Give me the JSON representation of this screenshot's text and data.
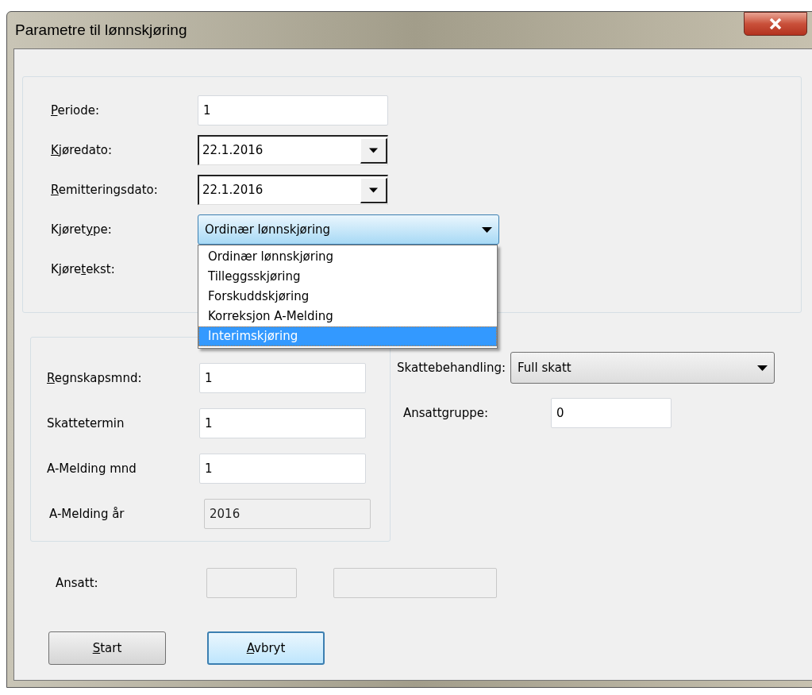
{
  "window": {
    "title": "Parametre til lønnskjøring"
  },
  "run_fields": [
    {
      "kind": "text",
      "label": {
        "key": "P",
        "after": "eriode:"
      },
      "value": "1"
    },
    {
      "kind": "date",
      "label": {
        "key": "K",
        "after": "jøredato:"
      },
      "value": "22.1.2016"
    },
    {
      "kind": "date",
      "label": {
        "key": "R",
        "after": "emitteringsdato:"
      },
      "value": "22.1.2016"
    },
    {
      "kind": "combo",
      "label": {
        "before": "Kjøret",
        "key": "y",
        "after": "pe:"
      },
      "value": "Ordinær lønnskjøring",
      "expanded": true,
      "options": [
        {
          "label": "Ordinær lønnskjøring",
          "highlighted": false
        },
        {
          "label": "Tilleggsskjøring",
          "highlighted": false
        },
        {
          "label": "Forskuddskjøring",
          "highlighted": false
        },
        {
          "label": "Korreksjon A-Melding",
          "highlighted": false
        },
        {
          "label": "Interimskjøring",
          "highlighted": true
        }
      ]
    },
    {
      "kind": "text",
      "label": {
        "before": "Kjøre",
        "key": "t",
        "after": "ekst:"
      }
    }
  ],
  "period_fields": [
    {
      "label": {
        "key": "R",
        "after": "egnskapsmnd:"
      },
      "value": "1",
      "disabled": false
    },
    {
      "label": "Skattetermin",
      "value": "1",
      "disabled": false
    },
    {
      "label": "A-Melding mnd",
      "value": "1",
      "disabled": false
    },
    {
      "label": "A-Melding år",
      "value": "2016",
      "disabled": true
    }
  ],
  "tax": {
    "label": "Skattebehandling:",
    "value": "Full skatt"
  },
  "employee_group": {
    "label": "Ansattgruppe:",
    "value": "0"
  },
  "employee": {
    "label": "Ansatt:",
    "disabled": true
  },
  "buttons": [
    {
      "label": {
        "key": "S",
        "after": "tart"
      },
      "focused": false
    },
    {
      "label": {
        "key": "A",
        "after": "vbryt"
      },
      "focused": true
    }
  ]
}
